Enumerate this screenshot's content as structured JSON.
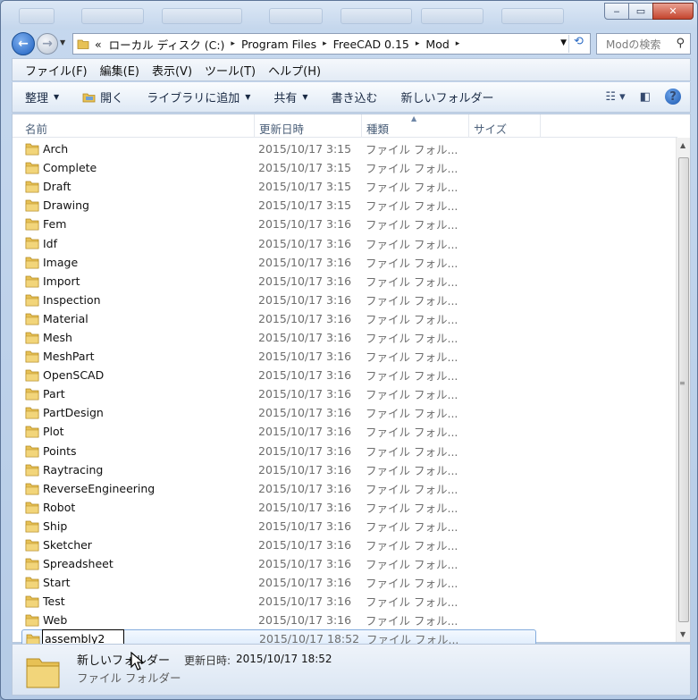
{
  "window": {
    "minimize_glyph": "‒",
    "maximize_glyph": "▭",
    "close_glyph": "✕"
  },
  "address_bar": {
    "overflow": "«",
    "crumbs": [
      "ローカル ディスク (C:)",
      "Program Files",
      "FreeCAD 0.15",
      "Mod"
    ],
    "separator": "▸"
  },
  "search": {
    "placeholder": "Modの検索"
  },
  "menu": [
    "ファイル(F)",
    "編集(E)",
    "表示(V)",
    "ツール(T)",
    "ヘルプ(H)"
  ],
  "commands": {
    "organize": "整理",
    "open": "開く",
    "add_library": "ライブラリに追加",
    "share": "共有",
    "burn": "書き込む",
    "new_folder": "新しいフォルダー"
  },
  "columns": {
    "name": "名前",
    "modified": "更新日時",
    "type": "種類",
    "size": "サイズ"
  },
  "files": [
    {
      "name": "Arch",
      "modified": "2015/10/17 3:15",
      "type": "ファイル フォル..."
    },
    {
      "name": "Complete",
      "modified": "2015/10/17 3:15",
      "type": "ファイル フォル..."
    },
    {
      "name": "Draft",
      "modified": "2015/10/17 3:15",
      "type": "ファイル フォル..."
    },
    {
      "name": "Drawing",
      "modified": "2015/10/17 3:15",
      "type": "ファイル フォル..."
    },
    {
      "name": "Fem",
      "modified": "2015/10/17 3:16",
      "type": "ファイル フォル..."
    },
    {
      "name": "Idf",
      "modified": "2015/10/17 3:16",
      "type": "ファイル フォル..."
    },
    {
      "name": "Image",
      "modified": "2015/10/17 3:16",
      "type": "ファイル フォル..."
    },
    {
      "name": "Import",
      "modified": "2015/10/17 3:16",
      "type": "ファイル フォル..."
    },
    {
      "name": "Inspection",
      "modified": "2015/10/17 3:16",
      "type": "ファイル フォル..."
    },
    {
      "name": "Material",
      "modified": "2015/10/17 3:16",
      "type": "ファイル フォル..."
    },
    {
      "name": "Mesh",
      "modified": "2015/10/17 3:16",
      "type": "ファイル フォル..."
    },
    {
      "name": "MeshPart",
      "modified": "2015/10/17 3:16",
      "type": "ファイル フォル..."
    },
    {
      "name": "OpenSCAD",
      "modified": "2015/10/17 3:16",
      "type": "ファイル フォル..."
    },
    {
      "name": "Part",
      "modified": "2015/10/17 3:16",
      "type": "ファイル フォル..."
    },
    {
      "name": "PartDesign",
      "modified": "2015/10/17 3:16",
      "type": "ファイル フォル..."
    },
    {
      "name": "Plot",
      "modified": "2015/10/17 3:16",
      "type": "ファイル フォル..."
    },
    {
      "name": "Points",
      "modified": "2015/10/17 3:16",
      "type": "ファイル フォル..."
    },
    {
      "name": "Raytracing",
      "modified": "2015/10/17 3:16",
      "type": "ファイル フォル..."
    },
    {
      "name": "ReverseEngineering",
      "modified": "2015/10/17 3:16",
      "type": "ファイル フォル..."
    },
    {
      "name": "Robot",
      "modified": "2015/10/17 3:16",
      "type": "ファイル フォル..."
    },
    {
      "name": "Ship",
      "modified": "2015/10/17 3:16",
      "type": "ファイル フォル..."
    },
    {
      "name": "Sketcher",
      "modified": "2015/10/17 3:16",
      "type": "ファイル フォル..."
    },
    {
      "name": "Spreadsheet",
      "modified": "2015/10/17 3:16",
      "type": "ファイル フォル..."
    },
    {
      "name": "Start",
      "modified": "2015/10/17 3:16",
      "type": "ファイル フォル..."
    },
    {
      "name": "Test",
      "modified": "2015/10/17 3:16",
      "type": "ファイル フォル..."
    },
    {
      "name": "Web",
      "modified": "2015/10/17 3:16",
      "type": "ファイル フォル..."
    }
  ],
  "renaming": {
    "value": "assembly2",
    "modified": "2015/10/17 18:52",
    "type": "ファイル フォル..."
  },
  "details": {
    "name": "新しいフォルダー",
    "modified_label": "更新日時:",
    "modified_value": "2015/10/17 18:52",
    "type": "ファイル フォルダー"
  },
  "colors": {
    "accent": "#3b78d6",
    "folder": "#e7c155",
    "selection": "#dcebfc"
  },
  "icons": {
    "folder": "folder-icon",
    "search": "search-icon",
    "help": "help-icon"
  }
}
